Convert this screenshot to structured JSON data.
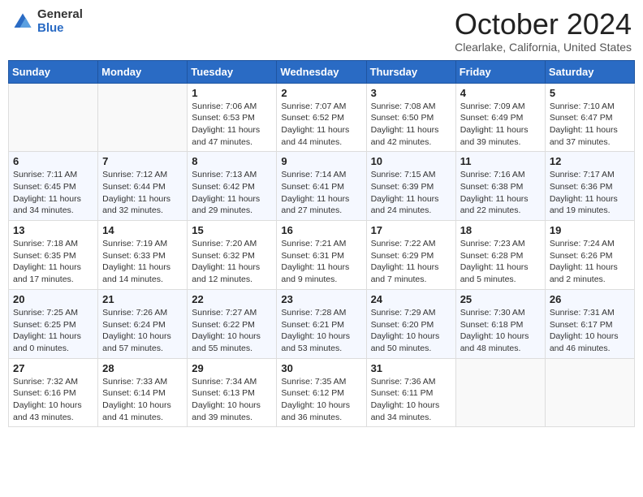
{
  "logo": {
    "general": "General",
    "blue": "Blue"
  },
  "header": {
    "month": "October 2024",
    "location": "Clearlake, California, United States"
  },
  "days_of_week": [
    "Sunday",
    "Monday",
    "Tuesday",
    "Wednesday",
    "Thursday",
    "Friday",
    "Saturday"
  ],
  "weeks": [
    [
      {
        "day": "",
        "sunrise": "",
        "sunset": "",
        "daylight": ""
      },
      {
        "day": "",
        "sunrise": "",
        "sunset": "",
        "daylight": ""
      },
      {
        "day": "1",
        "sunrise": "Sunrise: 7:06 AM",
        "sunset": "Sunset: 6:53 PM",
        "daylight": "Daylight: 11 hours and 47 minutes."
      },
      {
        "day": "2",
        "sunrise": "Sunrise: 7:07 AM",
        "sunset": "Sunset: 6:52 PM",
        "daylight": "Daylight: 11 hours and 44 minutes."
      },
      {
        "day": "3",
        "sunrise": "Sunrise: 7:08 AM",
        "sunset": "Sunset: 6:50 PM",
        "daylight": "Daylight: 11 hours and 42 minutes."
      },
      {
        "day": "4",
        "sunrise": "Sunrise: 7:09 AM",
        "sunset": "Sunset: 6:49 PM",
        "daylight": "Daylight: 11 hours and 39 minutes."
      },
      {
        "day": "5",
        "sunrise": "Sunrise: 7:10 AM",
        "sunset": "Sunset: 6:47 PM",
        "daylight": "Daylight: 11 hours and 37 minutes."
      }
    ],
    [
      {
        "day": "6",
        "sunrise": "Sunrise: 7:11 AM",
        "sunset": "Sunset: 6:45 PM",
        "daylight": "Daylight: 11 hours and 34 minutes."
      },
      {
        "day": "7",
        "sunrise": "Sunrise: 7:12 AM",
        "sunset": "Sunset: 6:44 PM",
        "daylight": "Daylight: 11 hours and 32 minutes."
      },
      {
        "day": "8",
        "sunrise": "Sunrise: 7:13 AM",
        "sunset": "Sunset: 6:42 PM",
        "daylight": "Daylight: 11 hours and 29 minutes."
      },
      {
        "day": "9",
        "sunrise": "Sunrise: 7:14 AM",
        "sunset": "Sunset: 6:41 PM",
        "daylight": "Daylight: 11 hours and 27 minutes."
      },
      {
        "day": "10",
        "sunrise": "Sunrise: 7:15 AM",
        "sunset": "Sunset: 6:39 PM",
        "daylight": "Daylight: 11 hours and 24 minutes."
      },
      {
        "day": "11",
        "sunrise": "Sunrise: 7:16 AM",
        "sunset": "Sunset: 6:38 PM",
        "daylight": "Daylight: 11 hours and 22 minutes."
      },
      {
        "day": "12",
        "sunrise": "Sunrise: 7:17 AM",
        "sunset": "Sunset: 6:36 PM",
        "daylight": "Daylight: 11 hours and 19 minutes."
      }
    ],
    [
      {
        "day": "13",
        "sunrise": "Sunrise: 7:18 AM",
        "sunset": "Sunset: 6:35 PM",
        "daylight": "Daylight: 11 hours and 17 minutes."
      },
      {
        "day": "14",
        "sunrise": "Sunrise: 7:19 AM",
        "sunset": "Sunset: 6:33 PM",
        "daylight": "Daylight: 11 hours and 14 minutes."
      },
      {
        "day": "15",
        "sunrise": "Sunrise: 7:20 AM",
        "sunset": "Sunset: 6:32 PM",
        "daylight": "Daylight: 11 hours and 12 minutes."
      },
      {
        "day": "16",
        "sunrise": "Sunrise: 7:21 AM",
        "sunset": "Sunset: 6:31 PM",
        "daylight": "Daylight: 11 hours and 9 minutes."
      },
      {
        "day": "17",
        "sunrise": "Sunrise: 7:22 AM",
        "sunset": "Sunset: 6:29 PM",
        "daylight": "Daylight: 11 hours and 7 minutes."
      },
      {
        "day": "18",
        "sunrise": "Sunrise: 7:23 AM",
        "sunset": "Sunset: 6:28 PM",
        "daylight": "Daylight: 11 hours and 5 minutes."
      },
      {
        "day": "19",
        "sunrise": "Sunrise: 7:24 AM",
        "sunset": "Sunset: 6:26 PM",
        "daylight": "Daylight: 11 hours and 2 minutes."
      }
    ],
    [
      {
        "day": "20",
        "sunrise": "Sunrise: 7:25 AM",
        "sunset": "Sunset: 6:25 PM",
        "daylight": "Daylight: 11 hours and 0 minutes."
      },
      {
        "day": "21",
        "sunrise": "Sunrise: 7:26 AM",
        "sunset": "Sunset: 6:24 PM",
        "daylight": "Daylight: 10 hours and 57 minutes."
      },
      {
        "day": "22",
        "sunrise": "Sunrise: 7:27 AM",
        "sunset": "Sunset: 6:22 PM",
        "daylight": "Daylight: 10 hours and 55 minutes."
      },
      {
        "day": "23",
        "sunrise": "Sunrise: 7:28 AM",
        "sunset": "Sunset: 6:21 PM",
        "daylight": "Daylight: 10 hours and 53 minutes."
      },
      {
        "day": "24",
        "sunrise": "Sunrise: 7:29 AM",
        "sunset": "Sunset: 6:20 PM",
        "daylight": "Daylight: 10 hours and 50 minutes."
      },
      {
        "day": "25",
        "sunrise": "Sunrise: 7:30 AM",
        "sunset": "Sunset: 6:18 PM",
        "daylight": "Daylight: 10 hours and 48 minutes."
      },
      {
        "day": "26",
        "sunrise": "Sunrise: 7:31 AM",
        "sunset": "Sunset: 6:17 PM",
        "daylight": "Daylight: 10 hours and 46 minutes."
      }
    ],
    [
      {
        "day": "27",
        "sunrise": "Sunrise: 7:32 AM",
        "sunset": "Sunset: 6:16 PM",
        "daylight": "Daylight: 10 hours and 43 minutes."
      },
      {
        "day": "28",
        "sunrise": "Sunrise: 7:33 AM",
        "sunset": "Sunset: 6:14 PM",
        "daylight": "Daylight: 10 hours and 41 minutes."
      },
      {
        "day": "29",
        "sunrise": "Sunrise: 7:34 AM",
        "sunset": "Sunset: 6:13 PM",
        "daylight": "Daylight: 10 hours and 39 minutes."
      },
      {
        "day": "30",
        "sunrise": "Sunrise: 7:35 AM",
        "sunset": "Sunset: 6:12 PM",
        "daylight": "Daylight: 10 hours and 36 minutes."
      },
      {
        "day": "31",
        "sunrise": "Sunrise: 7:36 AM",
        "sunset": "Sunset: 6:11 PM",
        "daylight": "Daylight: 10 hours and 34 minutes."
      },
      {
        "day": "",
        "sunrise": "",
        "sunset": "",
        "daylight": ""
      },
      {
        "day": "",
        "sunrise": "",
        "sunset": "",
        "daylight": ""
      }
    ]
  ]
}
